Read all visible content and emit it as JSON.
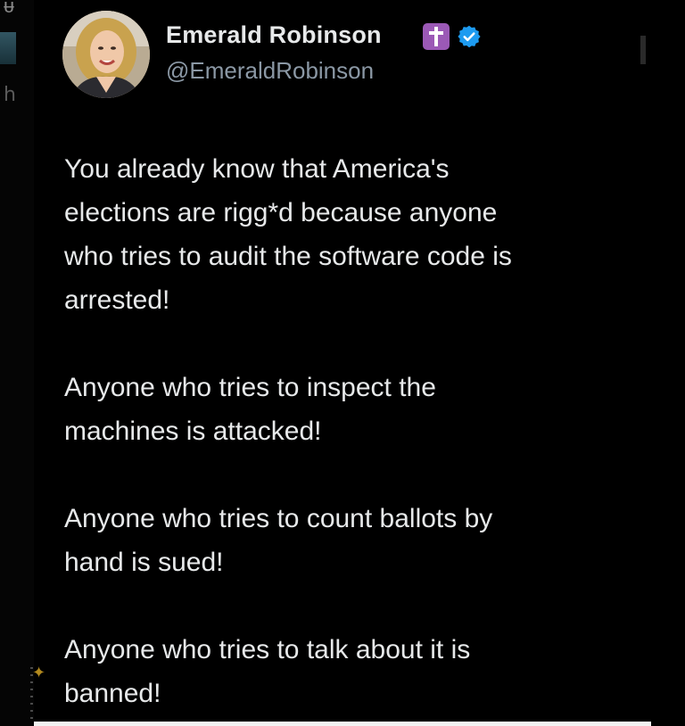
{
  "author": {
    "display_name": "Emerald Robinson",
    "handle": "@EmeraldRobinson",
    "badges": [
      "cross-icon",
      "verified-icon"
    ]
  },
  "tweet": {
    "paragraphs": [
      "You already know that America's\nelections are rigg*d because anyone\nwho tries to audit the software code is\narrested!",
      "Anyone who tries to inspect the\nmachines is attacked!",
      "Anyone who tries to count ballots by\nhand is sued!",
      "Anyone who tries to talk about it is\nbanned!"
    ]
  },
  "colors": {
    "background": "#000000",
    "text": "#e7e9ea",
    "handle": "#8b98a5",
    "verified": "#1d9bf0",
    "cross_badge": "#9b59b6"
  }
}
